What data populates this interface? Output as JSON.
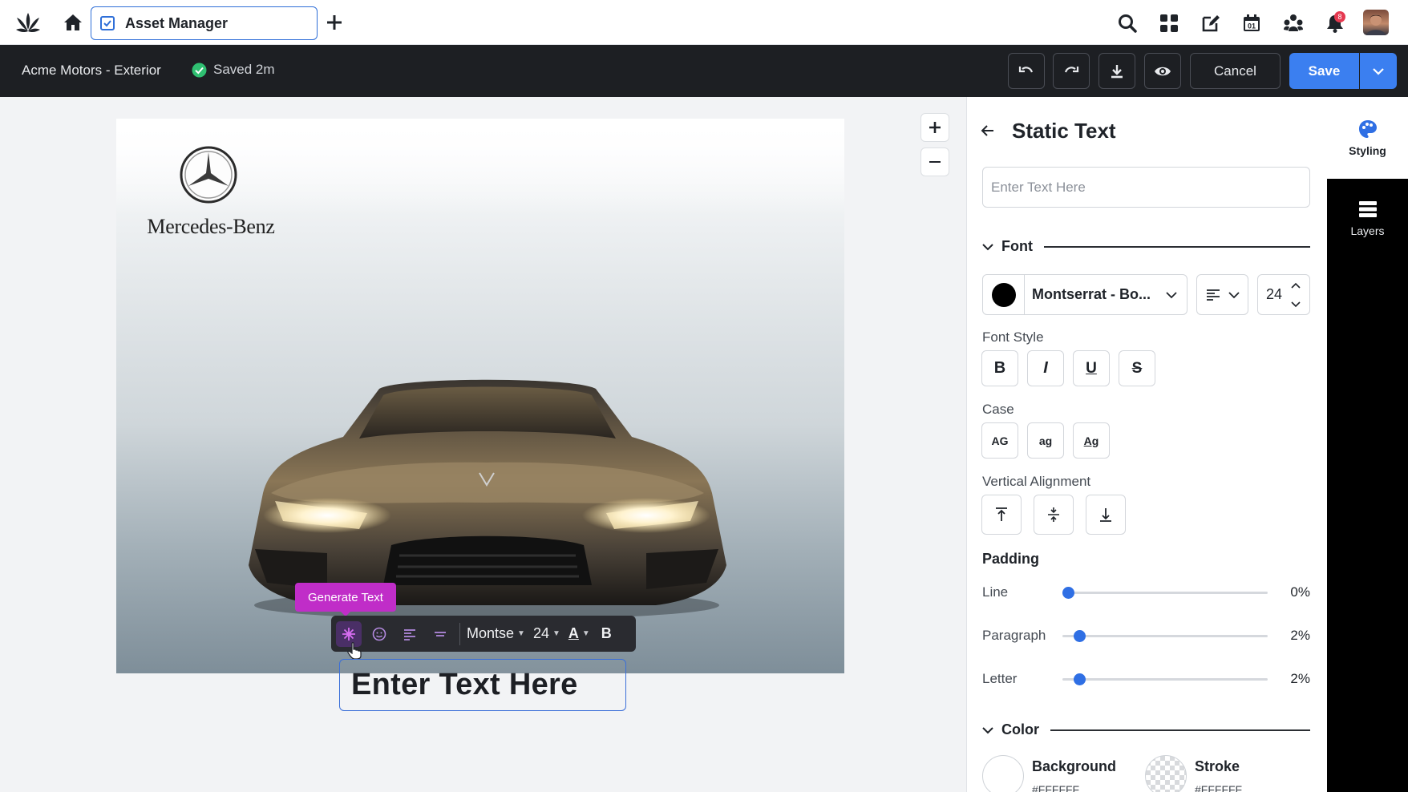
{
  "topbar": {
    "tab_label": "Asset Manager",
    "notification_count": "8",
    "icons": [
      "app-logo-icon",
      "home-icon",
      "asset-manager-tab-icon",
      "plus-icon",
      "search-icon",
      "apps-grid-icon",
      "compose-icon",
      "calendar-icon",
      "community-icon",
      "bell-icon"
    ],
    "calendar_day": "01"
  },
  "editor_bar": {
    "document_title": "Acme Motors - Exterior",
    "saved_status": "Saved 2m",
    "cancel_label": "Cancel",
    "save_label": "Save"
  },
  "canvas": {
    "brand_name": "Mercedes-Benz",
    "generate_text_label": "Generate Text",
    "toolbar": {
      "font_short": "Montse",
      "font_size": "24",
      "color_glyph": "A",
      "bold_glyph": "B"
    },
    "text_box_value": "Enter Text Here"
  },
  "panel": {
    "title": "Static Text",
    "text_input_placeholder": "Enter Text Here",
    "font_section": "Font",
    "font_color": "#000000",
    "font_name": "Montserrat - Bo...",
    "font_size": "24",
    "font_style_label": "Font Style",
    "font_style_buttons": [
      "B",
      "I",
      "U",
      "S"
    ],
    "case_label": "Case",
    "case_buttons": [
      "AG",
      "ag",
      "Ag"
    ],
    "vertical_alignment_label": "Vertical Alignment",
    "padding_label": "Padding",
    "padding": [
      {
        "label": "Line",
        "value": "0%",
        "fraction": 0.0
      },
      {
        "label": "Paragraph",
        "value": "2%",
        "fraction": 0.02
      },
      {
        "label": "Letter",
        "value": "2%",
        "fraction": 0.02
      }
    ],
    "color_section": "Color",
    "background_label": "Background",
    "background_hex": "#FFFFFF",
    "stroke_label": "Stroke",
    "stroke_hex": "#FFFFFF"
  },
  "rail": {
    "styling_label": "Styling",
    "layers_label": "Layers"
  },
  "colors": {
    "accent": "#3b7ff0",
    "generate_pill": "#c02dc8",
    "slider_knob": "#2f6fe4",
    "saved_check": "#2fbf71"
  }
}
